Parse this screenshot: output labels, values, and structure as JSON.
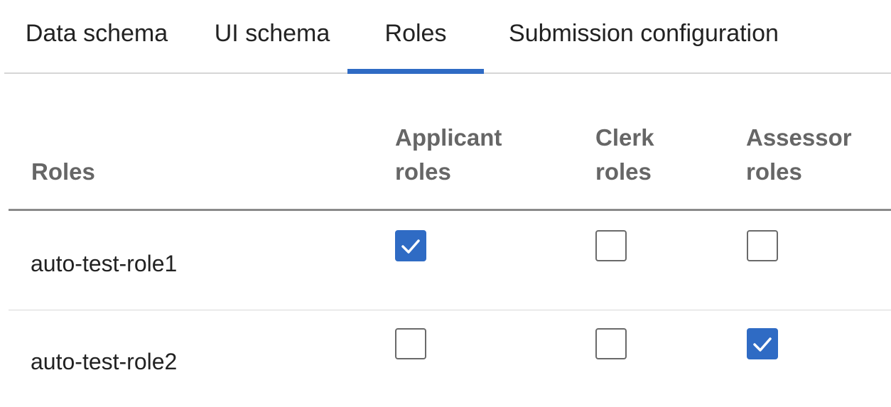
{
  "tabs": [
    {
      "label": "Data schema",
      "active": false
    },
    {
      "label": "UI schema",
      "active": false
    },
    {
      "label": "Roles",
      "active": true
    },
    {
      "label": "Submission configuration",
      "active": false
    }
  ],
  "table": {
    "headers": {
      "roles": "Roles",
      "applicant": "Applicant roles",
      "clerk": "Clerk roles",
      "assessor": "Assessor roles"
    },
    "rows": [
      {
        "name": "auto-test-role1",
        "applicant": true,
        "clerk": false,
        "assessor": false
      },
      {
        "name": "auto-test-role2",
        "applicant": false,
        "clerk": false,
        "assessor": true
      }
    ]
  },
  "colors": {
    "accent": "#2f6bc4",
    "header_text": "#666666"
  },
  "icons": {
    "check": "checkmark-icon"
  }
}
